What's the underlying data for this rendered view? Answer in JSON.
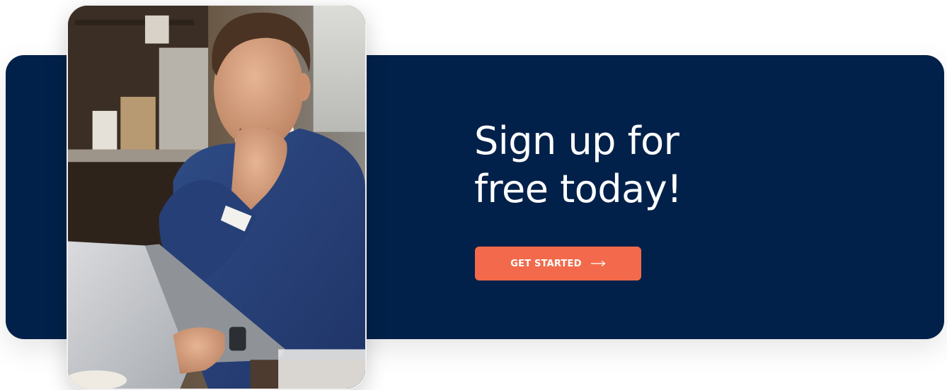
{
  "cta": {
    "heading_line1": "Sign up for",
    "heading_line2": "free today!",
    "button_label": "GET STARTED",
    "button_icon": "arrow-right-icon"
  },
  "photo": {
    "subject": "man-smiling-at-laptop-photo"
  },
  "colors": {
    "banner_background": "#02214a",
    "button_background": "#f26a4b",
    "heading_text": "#ffffff",
    "button_text": "#ffffff"
  }
}
